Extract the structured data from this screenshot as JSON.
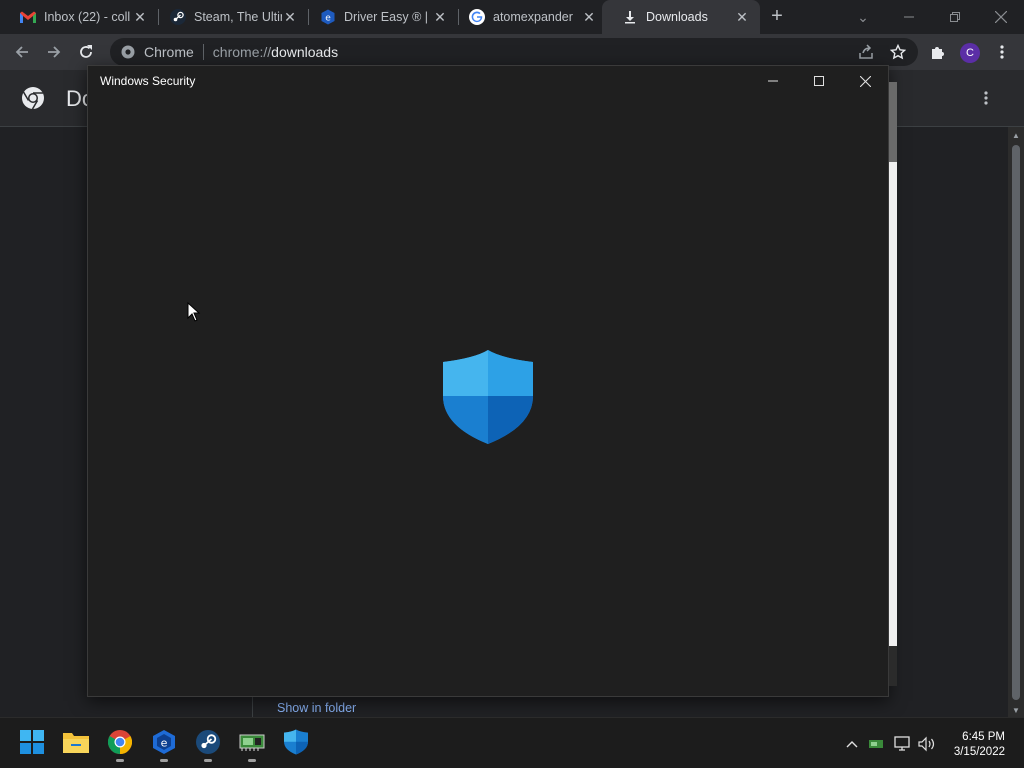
{
  "browser": {
    "tabs": [
      {
        "title": "Inbox (22) - coll",
        "icon": "gmail-icon",
        "active": false
      },
      {
        "title": "Steam, The Ultim",
        "icon": "steam-icon",
        "active": false
      },
      {
        "title": "Driver Easy ® |",
        "icon": "driver-easy-icon",
        "active": false
      },
      {
        "title": "atomexpander",
        "icon": "google-icon",
        "active": false
      },
      {
        "title": "Downloads",
        "icon": "download-icon",
        "active": true
      }
    ],
    "new_tab": "+",
    "omnibox": {
      "scheme_label": "Chrome",
      "url_prefix": "chrome://",
      "url_host": "downloads"
    },
    "profile_initial": "C"
  },
  "downloads_page": {
    "title": "Downloads",
    "show_in_folder": "Show in folder"
  },
  "security_window": {
    "title": "Windows Security",
    "logo": "shield-icon"
  },
  "taskbar": {
    "apps": [
      "start-icon",
      "file-explorer-icon",
      "chrome-icon",
      "driver-easy-icon",
      "steam-icon",
      "network-card-icon",
      "windows-security-icon"
    ],
    "time": "6:45 PM",
    "date": "3/15/2022"
  },
  "colors": {
    "accent": "#8ab4f8",
    "shield_light": "#3aa8e8",
    "shield_dark": "#0a5fb0"
  }
}
